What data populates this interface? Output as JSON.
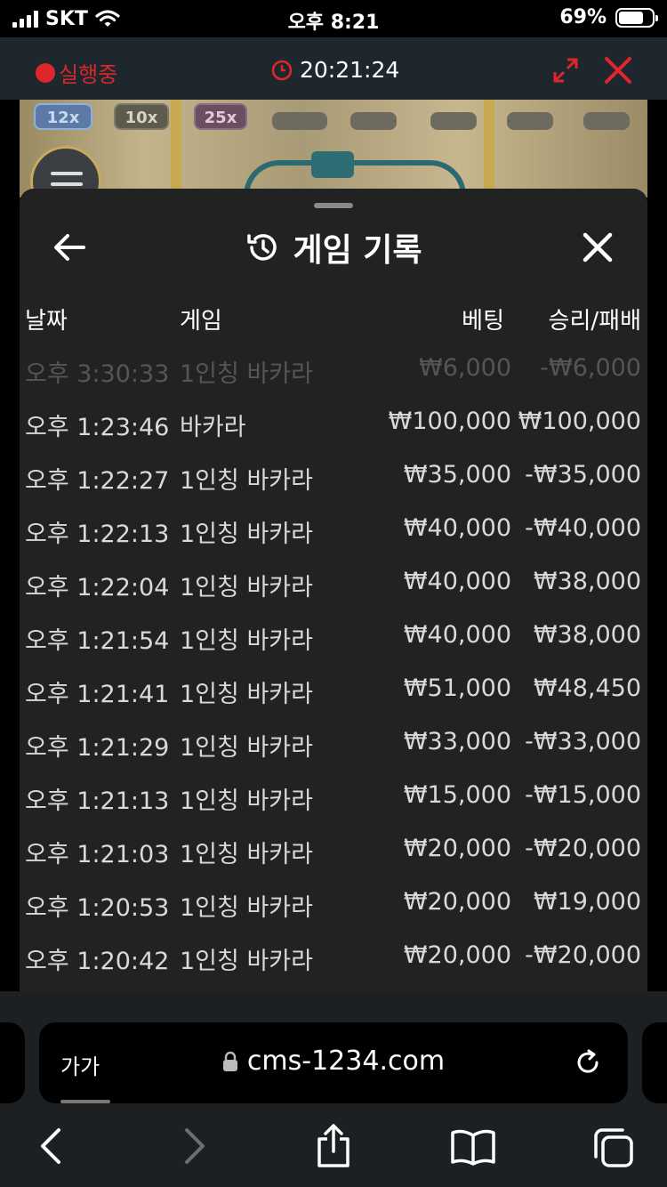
{
  "status_bar": {
    "carrier": "SKT",
    "time": "오후 8:21",
    "battery": "69%"
  },
  "game_bar": {
    "status": "실행중",
    "clock": "20:21:24"
  },
  "preview": {
    "multipliers": [
      "12x",
      "10x",
      "25x"
    ]
  },
  "sheet": {
    "title": "게임 기록",
    "columns": {
      "date": "날짜",
      "game": "게임",
      "bet": "베팅",
      "result": "승리/패배"
    },
    "rows": [
      {
        "time": "오후 3:30:33",
        "game": "1인칭 바카라",
        "bet": "₩6,000",
        "result": "-₩6,000"
      },
      {
        "time": "오후 1:23:46",
        "game": "바카라",
        "bet": "₩100,000",
        "result": "₩100,000"
      },
      {
        "time": "오후 1:22:27",
        "game": "1인칭 바카라",
        "bet": "₩35,000",
        "result": "-₩35,000"
      },
      {
        "time": "오후 1:22:13",
        "game": "1인칭 바카라",
        "bet": "₩40,000",
        "result": "-₩40,000"
      },
      {
        "time": "오후 1:22:04",
        "game": "1인칭 바카라",
        "bet": "₩40,000",
        "result": "₩38,000"
      },
      {
        "time": "오후 1:21:54",
        "game": "1인칭 바카라",
        "bet": "₩40,000",
        "result": "₩38,000"
      },
      {
        "time": "오후 1:21:41",
        "game": "1인칭 바카라",
        "bet": "₩51,000",
        "result": "₩48,450"
      },
      {
        "time": "오후 1:21:29",
        "game": "1인칭 바카라",
        "bet": "₩33,000",
        "result": "-₩33,000"
      },
      {
        "time": "오후 1:21:13",
        "game": "1인칭 바카라",
        "bet": "₩15,000",
        "result": "-₩15,000"
      },
      {
        "time": "오후 1:21:03",
        "game": "1인칭 바카라",
        "bet": "₩20,000",
        "result": "-₩20,000"
      },
      {
        "time": "오후 1:20:53",
        "game": "1인칭 바카라",
        "bet": "₩20,000",
        "result": "₩19,000"
      },
      {
        "time": "오후 1:20:42",
        "game": "1인칭 바카라",
        "bet": "₩20,000",
        "result": "-₩20,000"
      }
    ]
  },
  "browser": {
    "text_size_label": "가가",
    "url": "cms-1234.com"
  },
  "colors": {
    "accent_red": "#e0262a",
    "sheet_bg": "#222222",
    "page_bg": "#1e262e"
  }
}
